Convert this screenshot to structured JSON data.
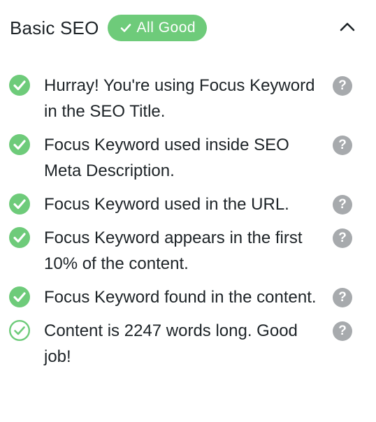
{
  "header": {
    "title": "Basic SEO",
    "badge_label": "All Good",
    "toggle_icon": "chevron-up-icon"
  },
  "items": [
    {
      "text": "Hurray! You're using Focus Keyword in the SEO Title.",
      "status": "passed",
      "help_label": "?"
    },
    {
      "text": "Focus Keyword used inside SEO Meta Description.",
      "status": "passed",
      "help_label": "?"
    },
    {
      "text": "Focus Keyword used in the URL.",
      "status": "passed",
      "help_label": "?"
    },
    {
      "text": "Focus Keyword appears in the first 10% of the content.",
      "status": "passed",
      "help_label": "?"
    },
    {
      "text": "Focus Keyword found in the content.",
      "status": "passed",
      "help_label": "?"
    },
    {
      "text": "Content is 2247 words long. Good job!",
      "status": "passed-outline",
      "help_label": "?"
    }
  ],
  "colors": {
    "success": "#6ecb7a",
    "help": "#a7aaad",
    "text": "#1d2327"
  }
}
